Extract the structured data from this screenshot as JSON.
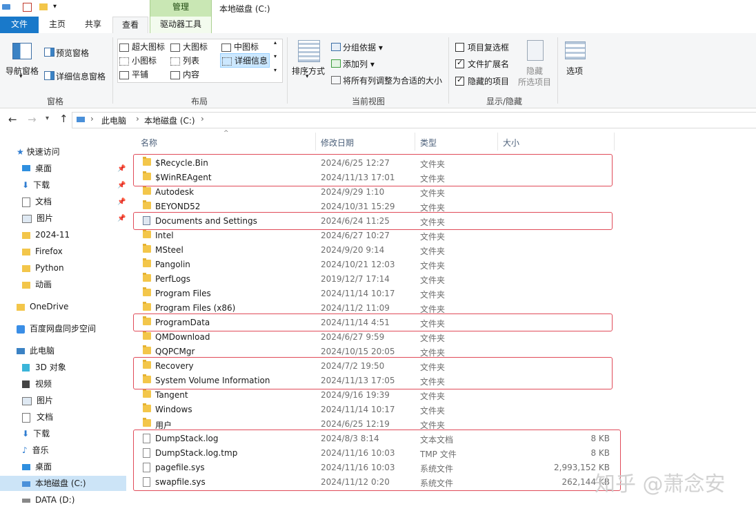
{
  "window": {
    "title": "本地磁盘 (C:)",
    "context_tab": "管理"
  },
  "ribbon_tabs": [
    "文件",
    "主页",
    "共享",
    "查看",
    "驱动器工具"
  ],
  "ribbon": {
    "panes": {
      "nav_pane": "导航窗格",
      "preview_pane": "预览窗格",
      "details_pane": "详细信息窗格",
      "group_label": "窗格"
    },
    "layout": {
      "items": [
        "超大图标",
        "大图标",
        "中图标",
        "小图标",
        "列表",
        "详细信息",
        "平铺",
        "内容"
      ],
      "selected": "详细信息",
      "group_label": "布局"
    },
    "current_view": {
      "sort_by": "排序方式",
      "group_by": "分组依据",
      "add_columns": "添加列",
      "size_all_columns": "将所有列调整为合适的大小",
      "group_label": "当前视图"
    },
    "show_hide": {
      "item_checkboxes": "项目复选框",
      "file_extensions": "文件扩展名",
      "hidden_items": "隐藏的项目",
      "item_checkboxes_checked": false,
      "file_extensions_checked": true,
      "hidden_items_checked": true,
      "hide_selected_1": "隐藏",
      "hide_selected_2": "所选项目",
      "group_label": "显示/隐藏"
    },
    "options": "选项"
  },
  "address": {
    "crumbs": [
      "此电脑",
      "本地磁盘 (C:)"
    ],
    "sep": "›"
  },
  "nav": {
    "quick_access": "快速访问",
    "quick_items": [
      "桌面",
      "下载",
      "文档",
      "图片",
      "2024-11",
      "Firefox",
      "Python",
      "动画"
    ],
    "onedrive": "OneDrive",
    "baidu": "百度网盘同步空间",
    "this_pc": "此电脑",
    "pc_items": [
      "3D 对象",
      "视频",
      "图片",
      "文档",
      "下载",
      "音乐",
      "桌面",
      "本地磁盘 (C:)",
      "DATA (D:)"
    ],
    "selected": "本地磁盘 (C:)"
  },
  "columns": {
    "name": "名称",
    "modified": "修改日期",
    "type": "类型",
    "size": "大小"
  },
  "files": [
    {
      "name": "$Recycle.Bin",
      "date": "2024/6/25 12:27",
      "type": "文件夹",
      "size": "",
      "kind": "folder"
    },
    {
      "name": "$WinREAgent",
      "date": "2024/11/13 17:01",
      "type": "文件夹",
      "size": "",
      "kind": "folder"
    },
    {
      "name": "Autodesk",
      "date": "2024/9/29 1:10",
      "type": "文件夹",
      "size": "",
      "kind": "folder"
    },
    {
      "name": "BEYOND52",
      "date": "2024/10/31 15:29",
      "type": "文件夹",
      "size": "",
      "kind": "folder"
    },
    {
      "name": "Documents and Settings",
      "date": "2024/6/24 11:25",
      "type": "文件夹",
      "size": "",
      "kind": "link"
    },
    {
      "name": "Intel",
      "date": "2024/6/27 10:27",
      "type": "文件夹",
      "size": "",
      "kind": "folder"
    },
    {
      "name": "MSteel",
      "date": "2024/9/20 9:14",
      "type": "文件夹",
      "size": "",
      "kind": "folder"
    },
    {
      "name": "Pangolin",
      "date": "2024/10/21 12:03",
      "type": "文件夹",
      "size": "",
      "kind": "folder"
    },
    {
      "name": "PerfLogs",
      "date": "2019/12/7 17:14",
      "type": "文件夹",
      "size": "",
      "kind": "folder"
    },
    {
      "name": "Program Files",
      "date": "2024/11/14 10:17",
      "type": "文件夹",
      "size": "",
      "kind": "folder"
    },
    {
      "name": "Program Files (x86)",
      "date": "2024/11/2 11:09",
      "type": "文件夹",
      "size": "",
      "kind": "folder"
    },
    {
      "name": "ProgramData",
      "date": "2024/11/14 4:51",
      "type": "文件夹",
      "size": "",
      "kind": "folder"
    },
    {
      "name": "QMDownload",
      "date": "2024/6/27 9:59",
      "type": "文件夹",
      "size": "",
      "kind": "folder"
    },
    {
      "name": "QQPCMgr",
      "date": "2024/10/15 20:05",
      "type": "文件夹",
      "size": "",
      "kind": "folder"
    },
    {
      "name": "Recovery",
      "date": "2024/7/2 19:50",
      "type": "文件夹",
      "size": "",
      "kind": "folder"
    },
    {
      "name": "System Volume Information",
      "date": "2024/11/13 17:05",
      "type": "文件夹",
      "size": "",
      "kind": "folder"
    },
    {
      "name": "Tangent",
      "date": "2024/9/16 19:39",
      "type": "文件夹",
      "size": "",
      "kind": "folder"
    },
    {
      "name": "Windows",
      "date": "2024/11/14 10:17",
      "type": "文件夹",
      "size": "",
      "kind": "folder"
    },
    {
      "name": "用户",
      "date": "2024/6/25 12:19",
      "type": "文件夹",
      "size": "",
      "kind": "folder"
    },
    {
      "name": "DumpStack.log",
      "date": "2024/8/3 8:14",
      "type": "文本文档",
      "size": "8 KB",
      "kind": "file"
    },
    {
      "name": "DumpStack.log.tmp",
      "date": "2024/11/16 10:03",
      "type": "TMP 文件",
      "size": "8 KB",
      "kind": "file"
    },
    {
      "name": "pagefile.sys",
      "date": "2024/11/16 10:03",
      "type": "系统文件",
      "size": "2,993,152 KB",
      "kind": "file"
    },
    {
      "name": "swapfile.sys",
      "date": "2024/11/12 0:20",
      "type": "系统文件",
      "size": "262,144 KB",
      "kind": "file"
    }
  ],
  "annotation_color": "#e04a58",
  "watermark": "知乎 @萧念安"
}
